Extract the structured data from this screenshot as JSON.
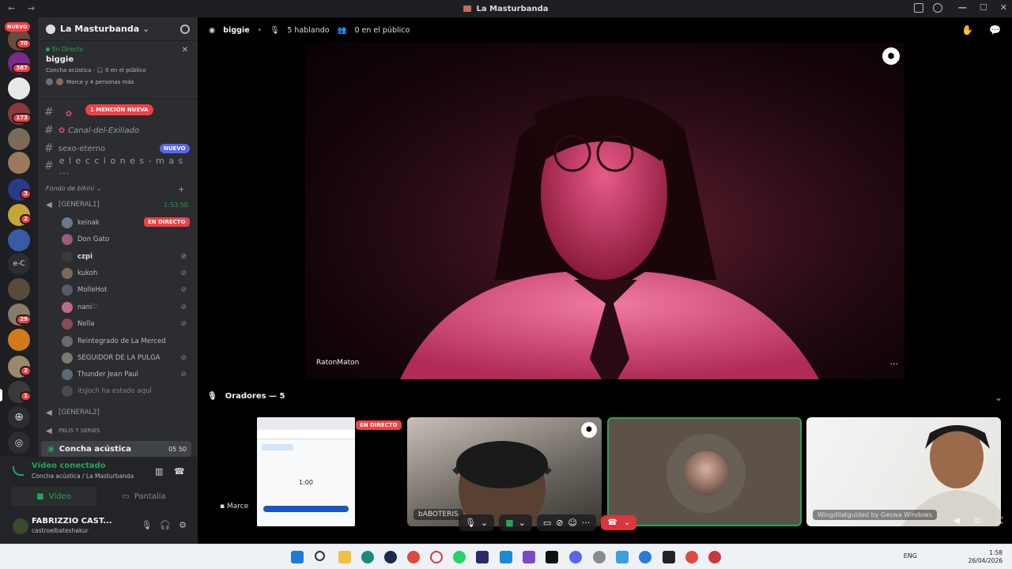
{
  "window": {
    "title": "La Masturbanda"
  },
  "servers": {
    "new_label": "NUEVO",
    "badges": [
      "70",
      "387",
      "173",
      "3",
      "2",
      "29",
      "2",
      "1"
    ]
  },
  "server_header": {
    "name": "La Masturbanda"
  },
  "live_panel": {
    "status": "En Directo",
    "title": "biggie",
    "subtitle": "Concha acústica · 🎧 0 en el público",
    "people": "Marce y 4 personas más"
  },
  "channels": [
    {
      "name": "Canal-del-Exiliado"
    },
    {
      "name": "sexo-eterno",
      "badge": "NUEVO"
    },
    {
      "name": "e l e c c i o n e s - m a s ..."
    }
  ],
  "mention_badge": "1 MENCIÓN NUEVA",
  "category": "Fondo de bikini",
  "voice_channels": {
    "general1": {
      "name": "[GENERAL1]",
      "timer": "1:53:50"
    },
    "general2": {
      "name": "[GENERAL2]"
    },
    "pelis": {
      "name": "PELIS Y SERIES"
    }
  },
  "live_label": "EN DIRECTO",
  "voice_users": [
    {
      "name": "keinak"
    },
    {
      "name": "Don Gato"
    },
    {
      "name": "czpi"
    },
    {
      "name": "kukoh"
    },
    {
      "name": "MolleHot"
    },
    {
      "name": "nani♡"
    },
    {
      "name": "Nella"
    },
    {
      "name": "Reintegrado de La Merced"
    },
    {
      "name": "SEGUIDOR DE LA PULGA"
    },
    {
      "name": "Thunder Jean Paul"
    },
    {
      "name": "itsJoch ha estado aquí"
    }
  ],
  "active_channel": {
    "name": "Concha acústica",
    "counts": "05  50"
  },
  "voice_status": {
    "title": "Vídeo conectado",
    "sub": "Concha acústica / La Masturbanda"
  },
  "buttons": {
    "video": "Vídeo",
    "screen": "Pantalla"
  },
  "me": {
    "name": "FABRIZZIO CAST...",
    "handle": "castroelbateshakur"
  },
  "stage": {
    "title": "biggie",
    "speaking": "5 hablando",
    "audience": "0 en el público",
    "spotlight_name": "RatonMaton",
    "speakers_label": "Oradores — 5"
  },
  "tiles": [
    {
      "label": "Marce"
    },
    {
      "label": "bABOTERIS"
    },
    {
      "label": ""
    },
    {
      "label": "Wingdilatguided by Geswa Windows"
    }
  ],
  "browser_mini": {
    "value": "1:00"
  },
  "taskbar": {
    "lang": "ENG",
    "time": "1:58",
    "date": "26/04/2026"
  },
  "colors": {
    "live": "#f23f43",
    "online": "#23a55a",
    "blurple": "#5865f2",
    "hangup": "#da373c"
  }
}
